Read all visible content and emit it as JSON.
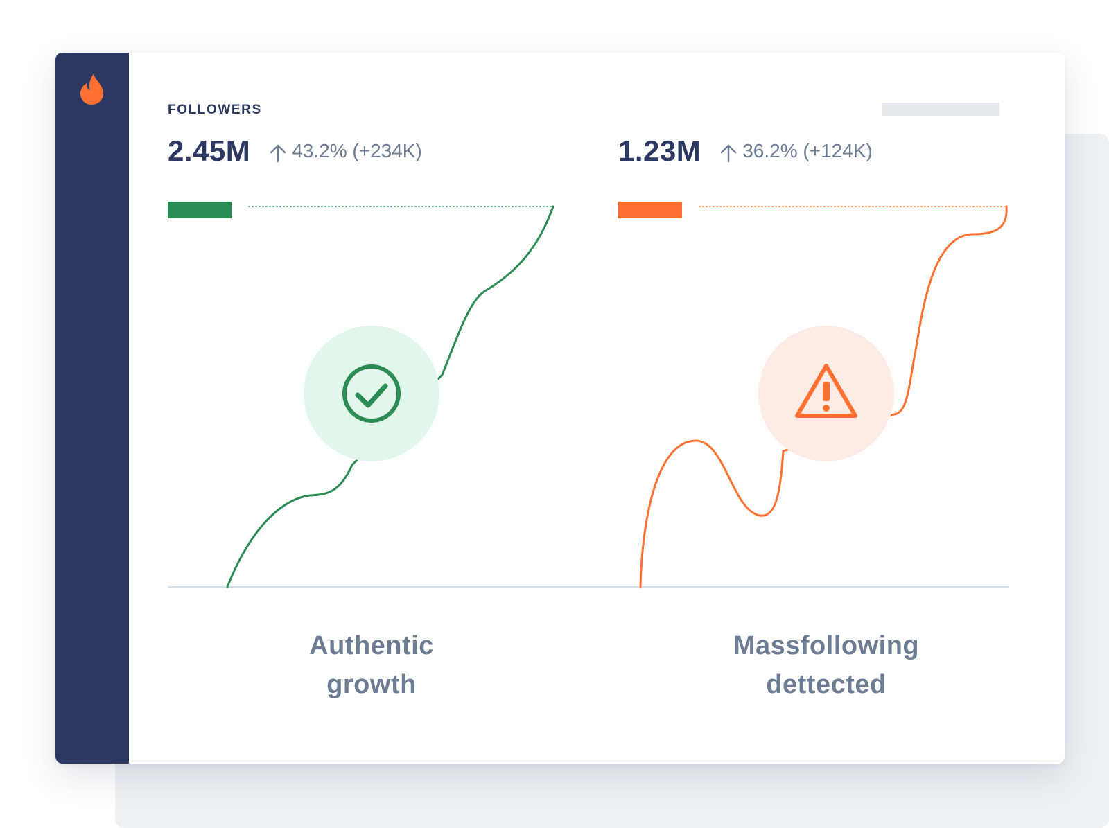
{
  "metric_label": "FOLLOWERS",
  "colors": {
    "sidebar": "#2d3862",
    "authentic": "#2a8c53",
    "authentic_bg": "#e3f6ea",
    "suspicious": "#ff7133",
    "suspicious_bg": "#fdece6",
    "text_dark": "#2d3862",
    "text_muted": "#6e7c93"
  },
  "logo": {
    "icon": "flame-icon"
  },
  "panels": [
    {
      "value": "2.45M",
      "change": "43.2% (+234K)",
      "change_icon": "arrow-up-icon",
      "status_icon": "check-circle-icon",
      "caption_line1": "Authentic",
      "caption_line2": "growth"
    },
    {
      "value": "1.23M",
      "change": "36.2% (+124K)",
      "change_icon": "arrow-up-icon",
      "status_icon": "warning-triangle-icon",
      "caption_line1": "Massfollowing",
      "caption_line2": "dettected"
    }
  ]
}
